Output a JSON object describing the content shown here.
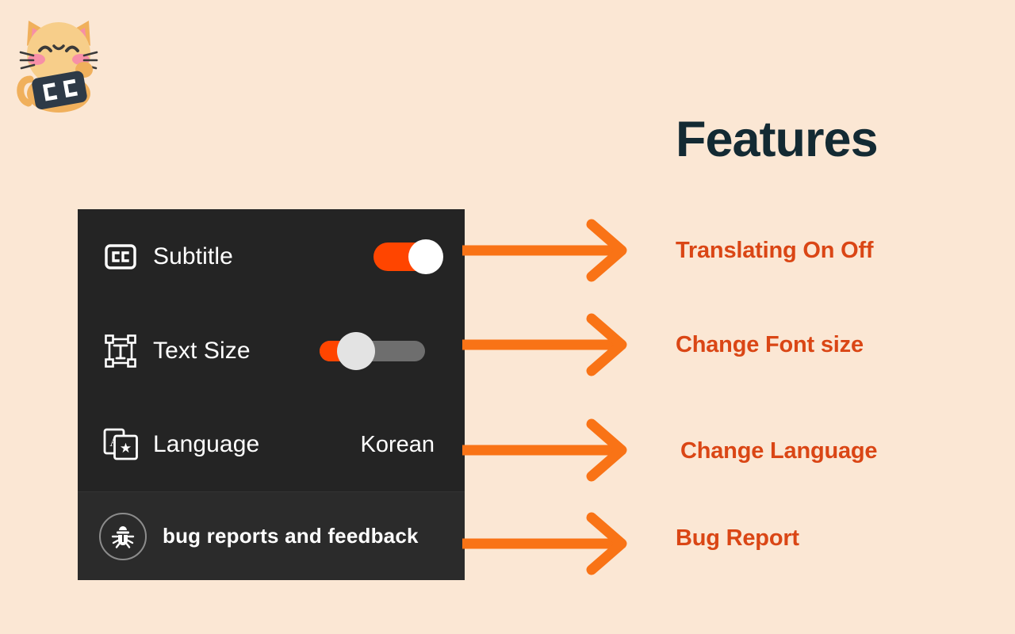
{
  "page": {
    "background_color": "#FBE7D4",
    "title": "Features"
  },
  "mascot": {
    "icon": "cat-with-cc-sign-mascot",
    "body_color": "#F5C97F",
    "cheek_color": "#F78FA7",
    "sign_color": "#2E3A47",
    "sign_text": "CC"
  },
  "panel": {
    "background_color": "#242424",
    "rows": [
      {
        "icon": "closed-caption-icon",
        "label": "Subtitle",
        "control": "toggle",
        "toggle_on": true,
        "accent_color": "#FF4500"
      },
      {
        "icon": "text-size-icon",
        "label": "Text Size",
        "control": "slider",
        "slider_percent": 30,
        "accent_color": "#FF4500"
      },
      {
        "icon": "translate-icon",
        "label": "Language",
        "control": "value",
        "value": "Korean"
      },
      {
        "icon": "bug-icon",
        "label": "bug reports and feedback",
        "control": "none"
      }
    ]
  },
  "callouts": {
    "heading": "Features",
    "heading_color": "#132A33",
    "arrow_color": "#F97316",
    "text_color": "#DA4615",
    "items": [
      {
        "label": "Translating On Off"
      },
      {
        "label": "Change Font size"
      },
      {
        "label": "Change Language"
      },
      {
        "label": "Bug Report"
      }
    ]
  }
}
